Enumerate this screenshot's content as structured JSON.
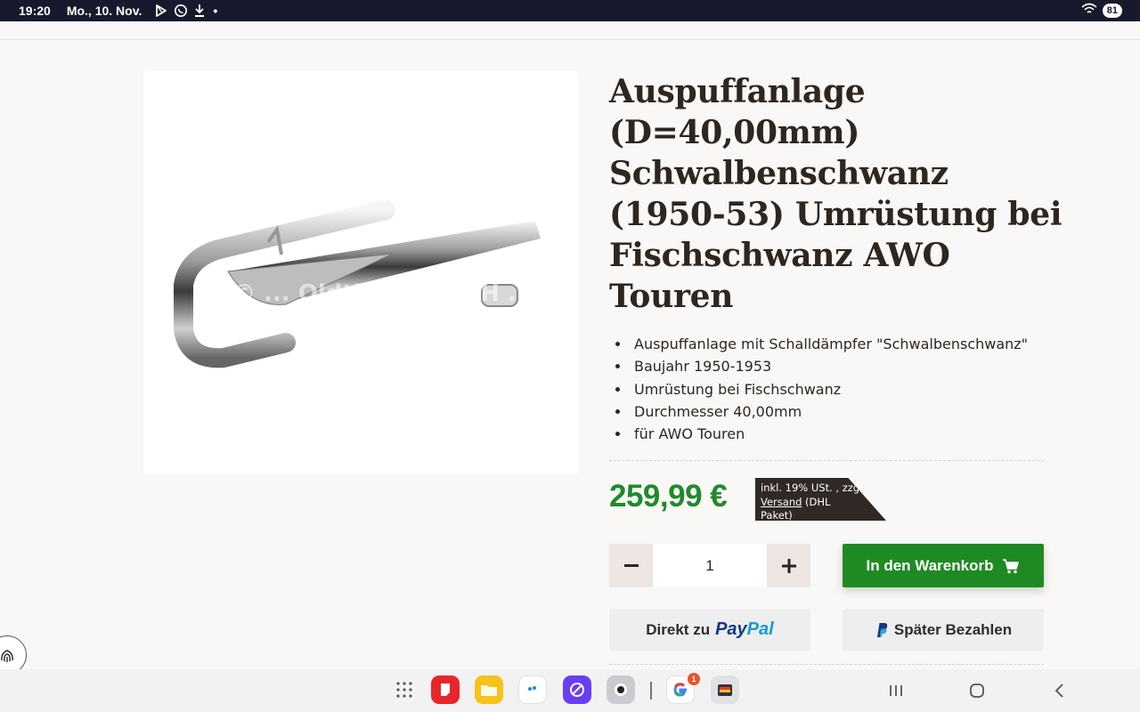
{
  "statusbar": {
    "time": "19:20",
    "date": "Mo., 10. Nov.",
    "battery": "81",
    "icons": [
      "play-store-icon",
      "whatsapp-icon",
      "download-icon",
      "wifi-icon"
    ]
  },
  "product": {
    "title": "Auspuffanlage (D=40,00mm) Schwalbenschwanz (1950-53) Umrüstung bei Fischschwanz AWO Touren",
    "image_watermark": "© ... Oldtimer GmbH ...",
    "features": [
      "Auspuffanlage mit Schalldämpfer \"Schwalbenschwanz\"",
      "Baujahr 1950-1953",
      "Umrüstung bei Fischschwanz",
      "Durchmesser 40,00mm",
      "für AWO Touren"
    ],
    "price": "259,99 €",
    "tax_note_line1": "inkl. 19% USt. , zzgl.",
    "tax_note_link": "Versand",
    "tax_note_rest": " (DHL",
    "tax_note_line3": "Paket)",
    "quantity": "1",
    "cart_label": "In den Warenkorb",
    "paypal_prefix": "Direkt zu",
    "paypal_pay": "Pay",
    "paypal_pal": "Pal",
    "pay_later_label": "Später Bezahlen"
  },
  "colors": {
    "price_green": "#1f8a2a",
    "cart_green": "#1f8a23",
    "statusbar": "#161a2c",
    "paypal_dark": "#123984",
    "paypal_light": "#169bd7"
  },
  "taskbar": {
    "apps": [
      "apps-grid-icon",
      "red-app-icon",
      "files-app-icon",
      "cloud-app-icon",
      "browser-app-icon",
      "camera-app-icon",
      "google-app-icon",
      "wallet-app-icon"
    ],
    "google_badge": "1"
  }
}
